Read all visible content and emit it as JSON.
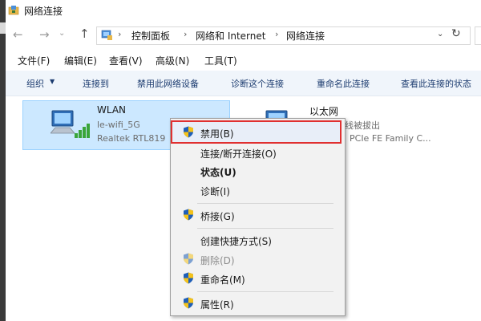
{
  "window": {
    "title": "网络连接"
  },
  "address": {
    "breadcrumbs": [
      "控制面板",
      "网络和 Internet",
      "网络连接"
    ],
    "separator": "›"
  },
  "menubar": [
    "文件(F)",
    "编辑(E)",
    "查看(V)",
    "高级(N)",
    "工具(T)"
  ],
  "commands": [
    "组织",
    "连接到",
    "禁用此网络设备",
    "诊断这个连接",
    "重命名此连接",
    "查看此连接的状态"
  ],
  "connections": {
    "wlan": {
      "name": "WLAN",
      "network": "le-wifi_5G",
      "adapter": "Realtek RTL819"
    },
    "ethernet": {
      "name": "以太网",
      "status": "线被拔出",
      "adapter": "PCIe FE Family C..."
    }
  },
  "context_menu": {
    "disable": "禁用(B)",
    "connect": "连接/断开连接(O)",
    "status": "状态(U)",
    "diagnose": "诊断(I)",
    "bridge": "桥接(G)",
    "shortcut": "创建快捷方式(S)",
    "delete": "删除(D)",
    "rename": "重命名(M)",
    "properties": "属性(R)"
  },
  "colors": {
    "selection": "#cce8ff",
    "highlight_border": "#e03030",
    "command_text": "#1b3b6f"
  }
}
